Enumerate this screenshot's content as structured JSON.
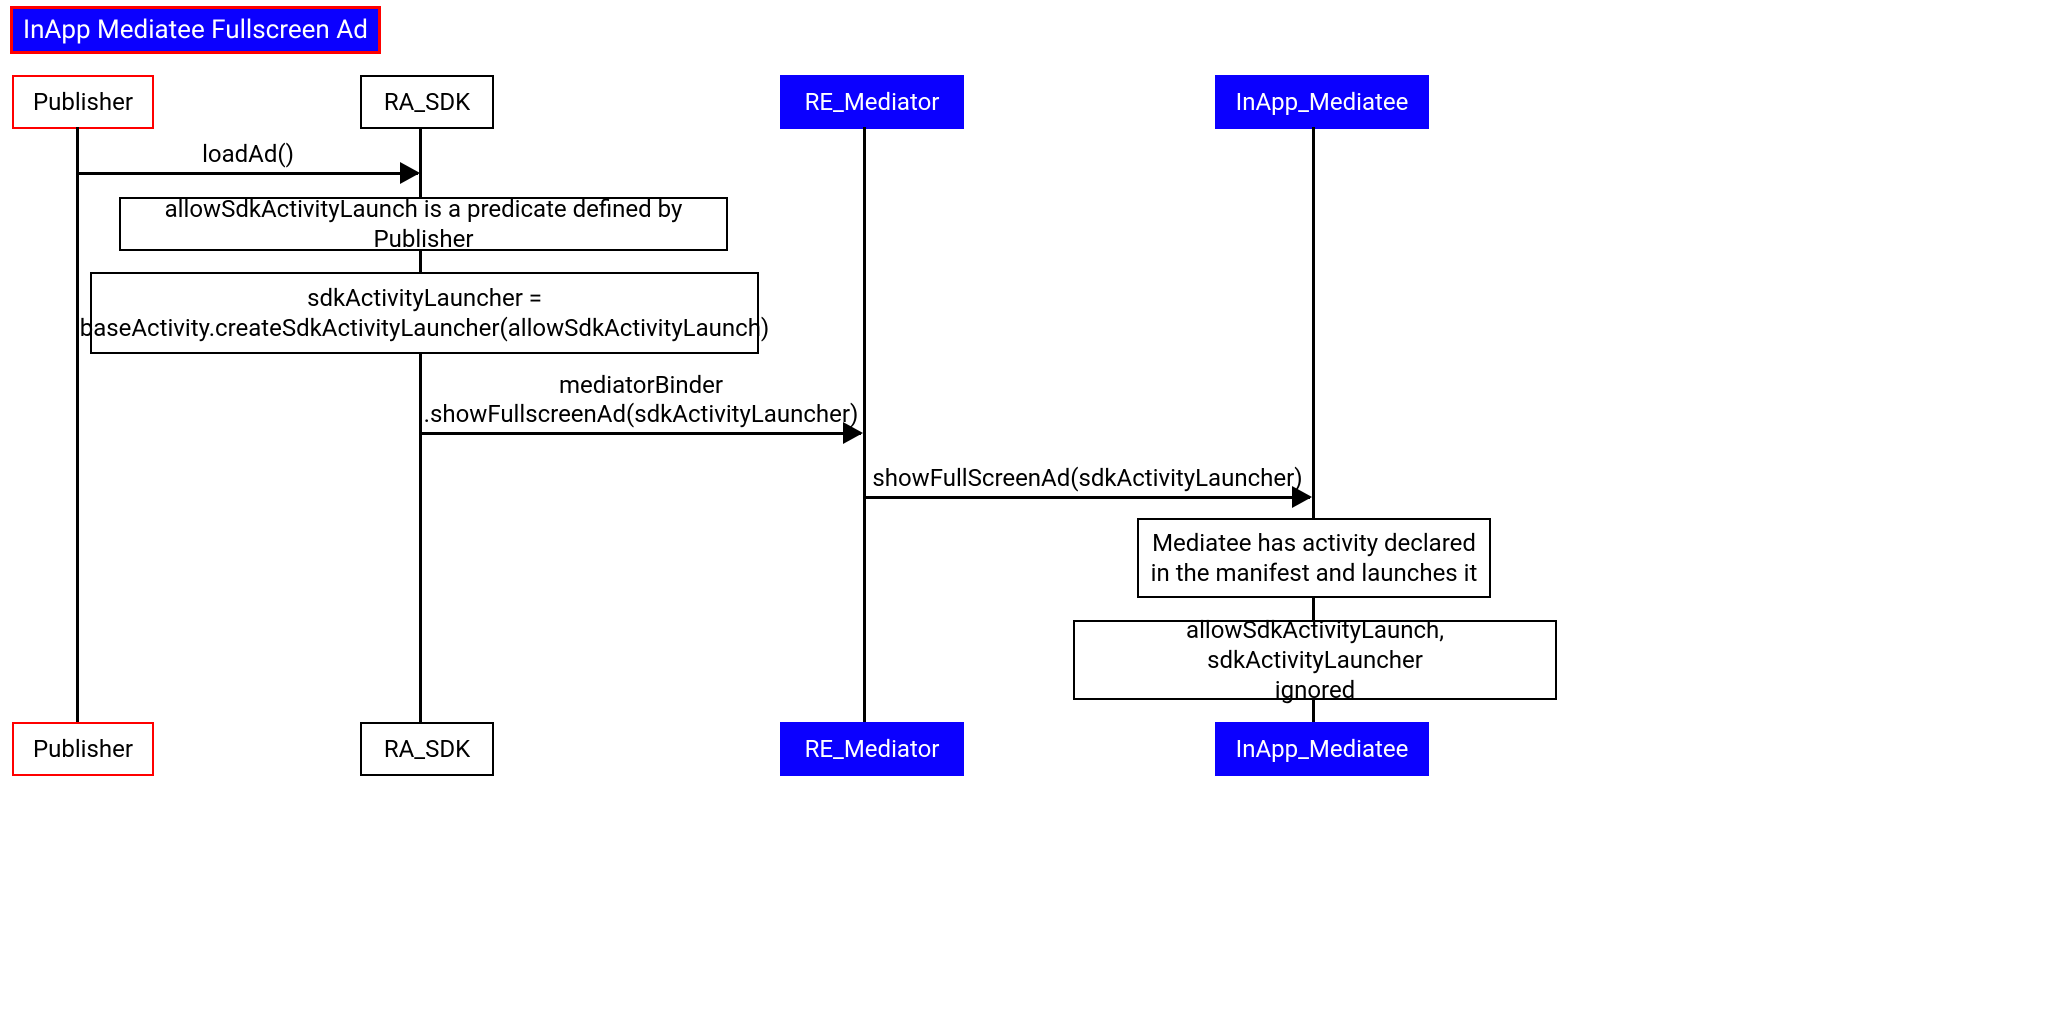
{
  "title": "InApp Mediatee Fullscreen Ad",
  "participants": {
    "publisher": "Publisher",
    "ra_sdk": "RA_SDK",
    "re_mediator": "RE_Mediator",
    "inapp_mediatee": "InApp_Mediatee"
  },
  "messages": {
    "m1": "loadAd()",
    "m2": "mediatorBinder\n.showFullscreenAd(sdkActivityLauncher)",
    "m3": "showFullScreenAd(sdkActivityLauncher)"
  },
  "notes": {
    "n1": "allowSdkActivityLaunch is a predicate defined by Publisher",
    "n2": "sdkActivityLauncher =\nbaseActivity.createSdkActivityLauncher(allowSdkActivityLaunch)",
    "n3": "Mediatee has activity declared\nin the manifest and launches it",
    "n4": "allowSdkActivityLaunch, sdkActivityLauncher\nignored"
  }
}
